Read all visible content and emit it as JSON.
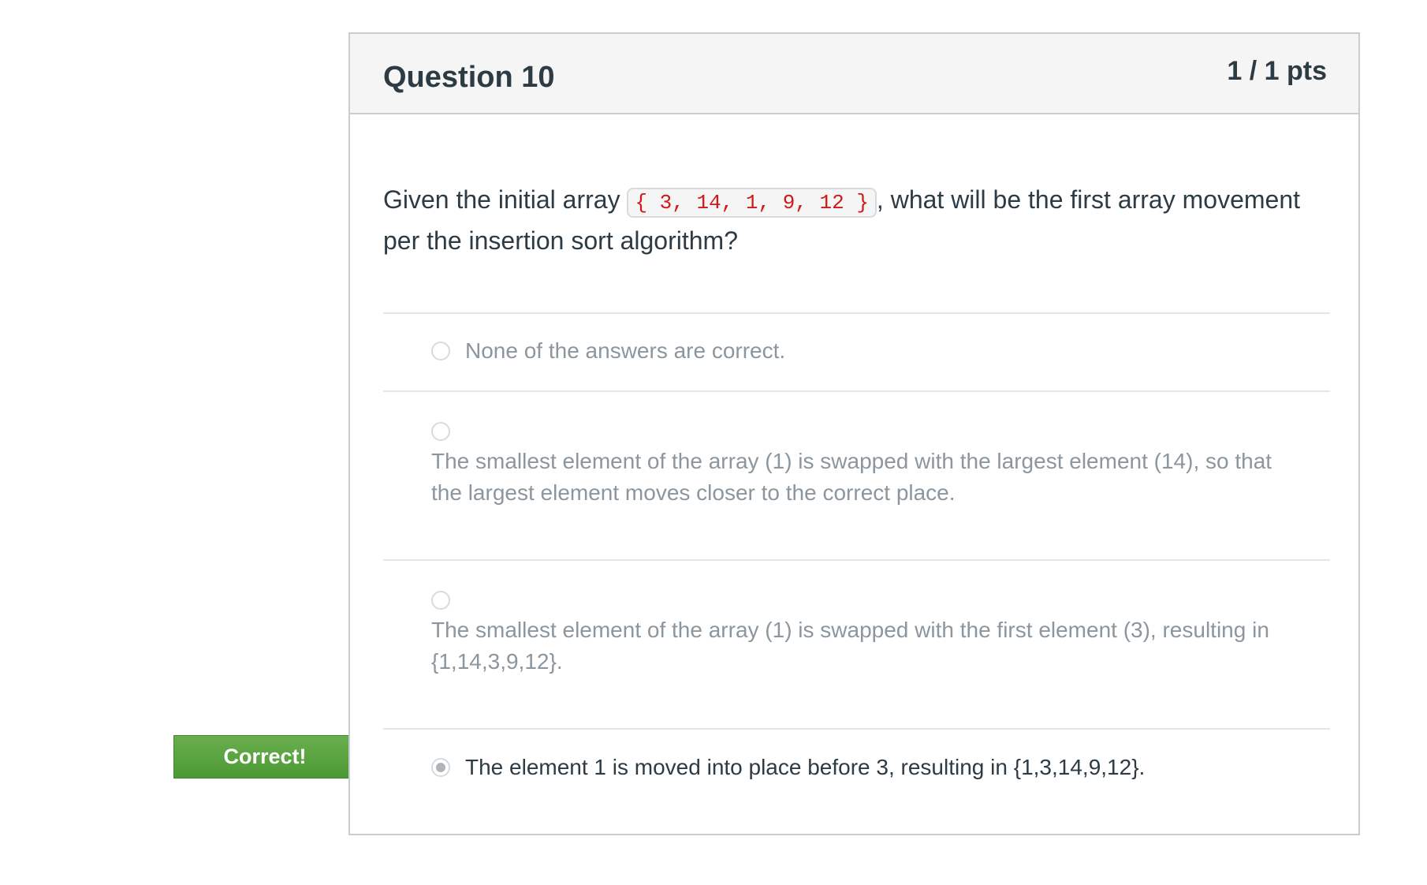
{
  "question": {
    "title": "Question 10",
    "points": "1 / 1 pts",
    "text_before": "Given the initial array ",
    "code": "{ 3, 14, 1, 9, 12 }",
    "text_after": ", what will be the first array movement per the insertion sort algorithm?"
  },
  "answers": [
    {
      "text": "None of the answers are correct.",
      "selected": false
    },
    {
      "text": "The smallest element of the array (1) is swapped with the largest element (14), so that the largest element moves closer to the correct place.",
      "selected": false
    },
    {
      "text": "The smallest element of the array (1) is swapped with the first element (3), resulting in {1,14,3,9,12}.",
      "selected": false
    },
    {
      "text": "The element 1 is moved into place before 3, resulting in {1,3,14,9,12}.",
      "selected": true
    }
  ],
  "feedback": {
    "correct_label": "Correct!"
  },
  "colors": {
    "correct_flag": "#5aa441",
    "code_text": "#d01919",
    "header_bg": "#f5f5f5"
  }
}
